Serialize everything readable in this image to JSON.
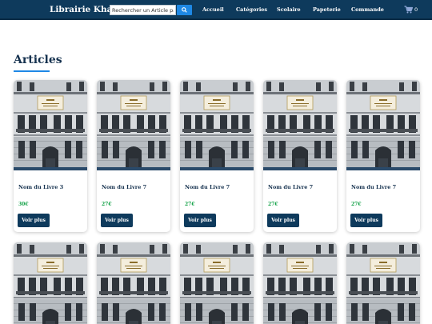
{
  "header": {
    "brand": "Librairie Khalsi",
    "search": {
      "placeholder": "Rechercher un Article par",
      "value": ""
    },
    "search_icon": "search-icon",
    "nav": [
      "Accueil",
      "Catégories",
      "Scolaire",
      "Papeterie",
      "Commande"
    ],
    "cart_icon": "shopping-cart-icon",
    "cart_count": "0"
  },
  "main": {
    "section_title": "Articles",
    "cards": [
      {
        "title": "Nom du Livre 3",
        "price": "30€",
        "button": "Voir plus"
      },
      {
        "title": "Nom du Livre 7",
        "price": "27€",
        "button": "Voir plus"
      },
      {
        "title": "Nom du Livre 7",
        "price": "27€",
        "button": "Voir plus"
      },
      {
        "title": "Nom du Livre 7",
        "price": "27€",
        "button": "Voir plus"
      },
      {
        "title": "Nom du Livre 7",
        "price": "27€",
        "button": "Voir plus"
      }
    ]
  },
  "colors": {
    "navbar": "#0e3a5c",
    "accent": "#1e88e5",
    "price": "#16a34a",
    "button": "#0e3a5c"
  }
}
